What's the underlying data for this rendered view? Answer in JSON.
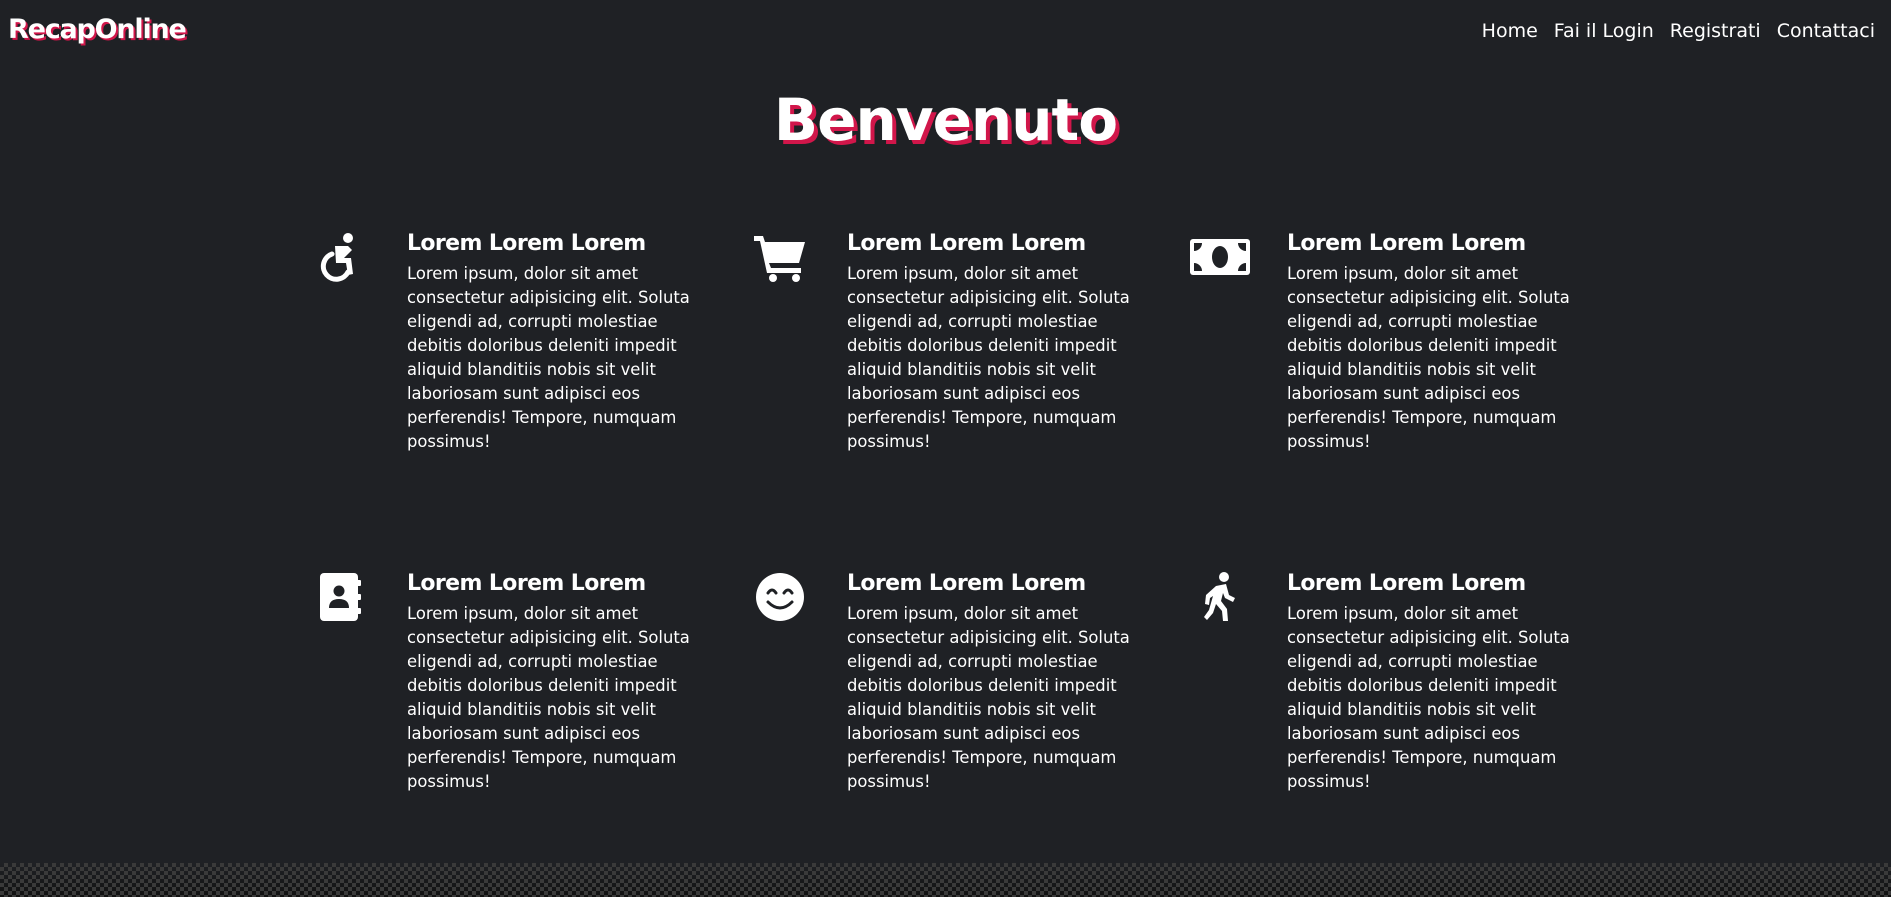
{
  "header": {
    "brand": "RecapOnline",
    "nav": [
      "Home",
      "Fai il Login",
      "Registrati",
      "Contattaci"
    ]
  },
  "hero": {
    "title": "Benvenuto"
  },
  "features": [
    {
      "icon": "wheelchair-icon",
      "title": "Lorem Lorem Lorem",
      "body": "Lorem ipsum, dolor sit amet consectetur adipisicing elit. Soluta eligendi ad, corrupti molestiae debitis doloribus deleniti impedit aliquid blanditiis nobis sit velit laboriosam sunt adipisci eos perferendis! Tempore, numquam possimus!"
    },
    {
      "icon": "cart-icon",
      "title": "Lorem Lorem Lorem",
      "body": "Lorem ipsum, dolor sit amet consectetur adipisicing elit. Soluta eligendi ad, corrupti molestiae debitis doloribus deleniti impedit aliquid blanditiis nobis sit velit laboriosam sunt adipisci eos perferendis! Tempore, numquam possimus!"
    },
    {
      "icon": "money-bill-icon",
      "title": "Lorem Lorem Lorem",
      "body": "Lorem ipsum, dolor sit amet consectetur adipisicing elit. Soluta eligendi ad, corrupti molestiae debitis doloribus deleniti impedit aliquid blanditiis nobis sit velit laboriosam sunt adipisci eos perferendis! Tempore, numquam possimus!"
    },
    {
      "icon": "address-book-icon",
      "title": "Lorem Lorem Lorem",
      "body": "Lorem ipsum, dolor sit amet consectetur adipisicing elit. Soluta eligendi ad, corrupti molestiae debitis doloribus deleniti impedit aliquid blanditiis nobis sit velit laboriosam sunt adipisci eos perferendis! Tempore, numquam possimus!"
    },
    {
      "icon": "smile-icon",
      "title": "Lorem Lorem Lorem",
      "body": "Lorem ipsum, dolor sit amet consectetur adipisicing elit. Soluta eligendi ad, corrupti molestiae debitis doloribus deleniti impedit aliquid blanditiis nobis sit velit laboriosam sunt adipisci eos perferendis! Tempore, numquam possimus!"
    },
    {
      "icon": "walking-icon",
      "title": "Lorem Lorem Lorem",
      "body": "Lorem ipsum, dolor sit amet consectetur adipisicing elit. Soluta eligendi ad, corrupti molestiae debitis doloribus deleniti impedit aliquid blanditiis nobis sit velit laboriosam sunt adipisci eos perferendis! Tempore, numquam possimus!"
    }
  ],
  "colors": {
    "background": "#1f2125",
    "accent": "#d1164a",
    "text": "#ffffff"
  }
}
